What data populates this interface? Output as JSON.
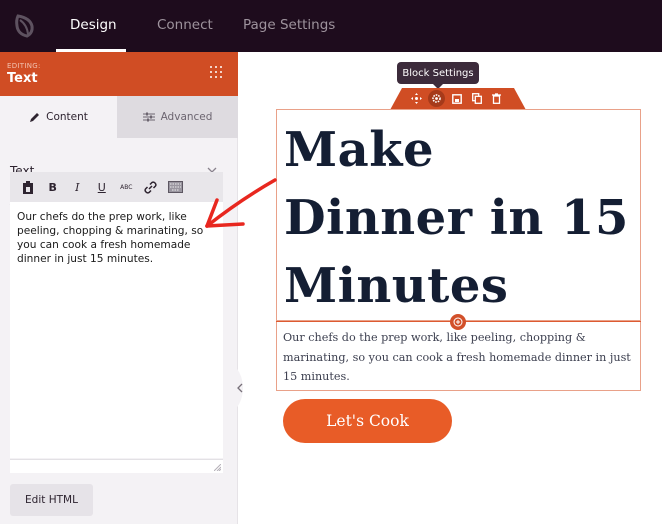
{
  "topbar": {
    "logo": "leaf-logo-icon",
    "tabs": [
      {
        "label": "Design",
        "active": true
      },
      {
        "label": "Connect",
        "active": false
      },
      {
        "label": "Page Settings",
        "active": false
      }
    ]
  },
  "panel": {
    "editing_label": "EDITING:",
    "editing_title": "Text",
    "tabs": [
      {
        "label": "Content",
        "icon": "pencil-icon",
        "active": true
      },
      {
        "label": "Advanced",
        "icon": "sliders-icon",
        "active": false
      }
    ],
    "section_title": "Text",
    "field_label": "Text",
    "toolbar": [
      "paste-icon",
      "bold-icon",
      "italic-icon",
      "underline-icon",
      "strikethrough-icon",
      "link-icon",
      "keyboard-icon"
    ],
    "toolbar_glyphs": {
      "bold": "B",
      "italic": "I",
      "underline": "U",
      "strike": "ABC"
    },
    "editor_text": "Our chefs do the prep work, like peeling, chopping & marinating, so you can cook a fresh homemade dinner in just 15 minutes.",
    "edit_html_label": "Edit HTML"
  },
  "canvas": {
    "tooltip": "Block Settings",
    "block_tools": [
      "move-icon",
      "gear-icon",
      "save-icon",
      "duplicate-icon",
      "trash-icon"
    ],
    "heading": "Make Dinner in 15 Minutes",
    "heading_lines": [
      "Make",
      "Dinner in 15",
      "Minutes"
    ],
    "paragraph": "Our chefs do the prep work, like peeling, chopping & marinating, so you can cook a fresh homemade dinner in just 15 minutes.",
    "cta_label": "Let's Cook"
  },
  "colors": {
    "topbar": "#1e0c1d",
    "accent": "#d04d24",
    "cta": "#e85c27",
    "heading": "#141e33",
    "annotation_arrow": "#e8271f"
  }
}
